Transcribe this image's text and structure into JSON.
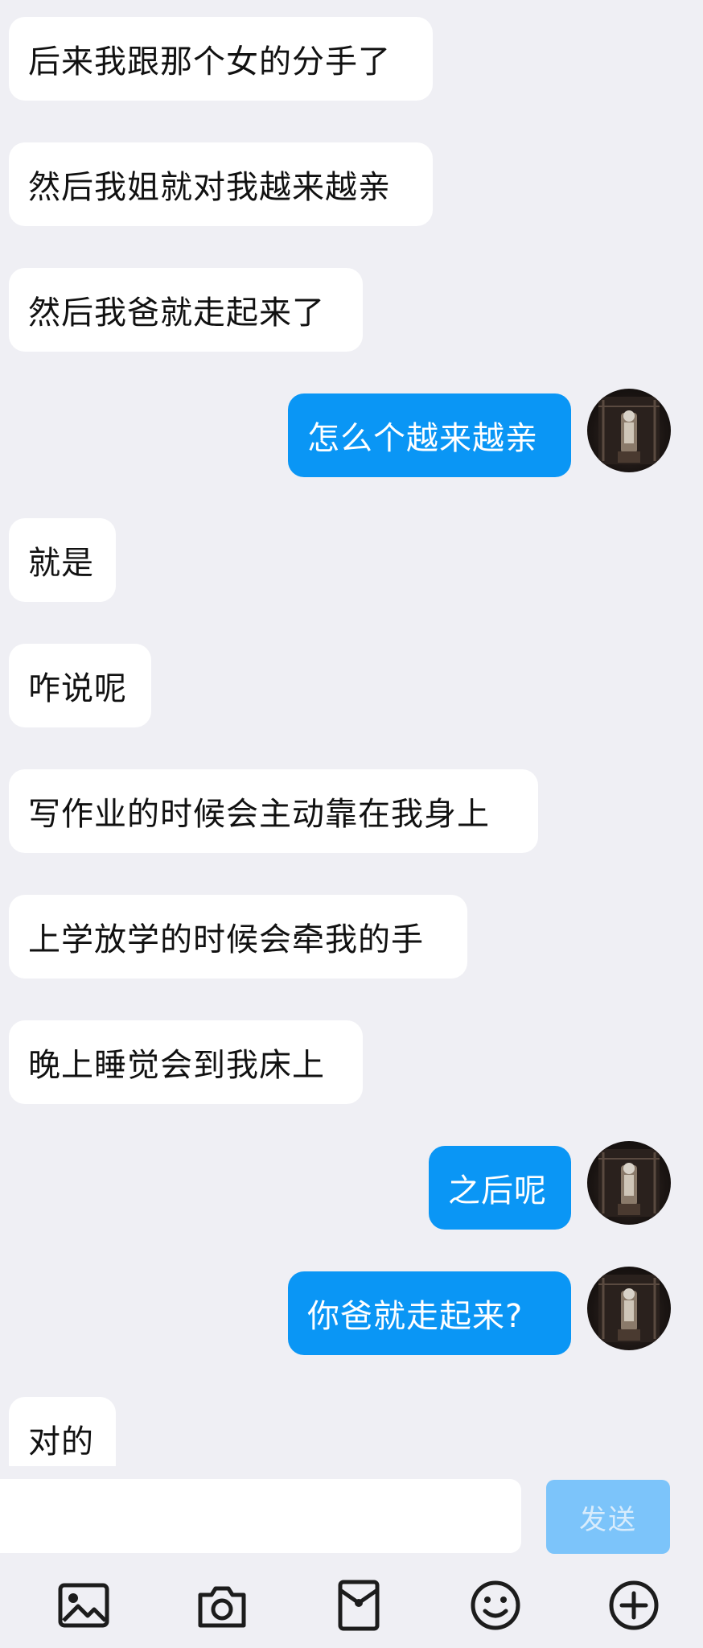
{
  "messages": [
    {
      "side": "in",
      "text": "后来我跟那个女的分手了"
    },
    {
      "side": "in",
      "text": "然后我姐就对我越来越亲"
    },
    {
      "side": "in",
      "text": "然后我爸就走起来了"
    },
    {
      "side": "out",
      "text": "怎么个越来越亲"
    },
    {
      "side": "in",
      "text": "就是"
    },
    {
      "side": "in",
      "text": "咋说呢"
    },
    {
      "side": "in",
      "text": "写作业的时候会主动靠在我身上"
    },
    {
      "side": "in",
      "text": "上学放学的时候会牵我的手"
    },
    {
      "side": "in",
      "text": "晚上睡觉会到我床上"
    },
    {
      "side": "out",
      "text": "之后呢"
    },
    {
      "side": "out",
      "text": "你爸就走起来?"
    },
    {
      "side": "in",
      "text": "对的"
    }
  ],
  "input": {
    "value": "",
    "placeholder": "",
    "send_label": "发送"
  },
  "toolbar": {
    "icons": [
      "image-icon",
      "camera-icon",
      "red-packet-icon",
      "emoji-icon",
      "plus-icon"
    ]
  },
  "colors": {
    "outgoing_bubble": "#0a96f5",
    "incoming_bubble": "#ffffff",
    "background": "#efeff4",
    "send_button_disabled": "#7cc4fa"
  }
}
